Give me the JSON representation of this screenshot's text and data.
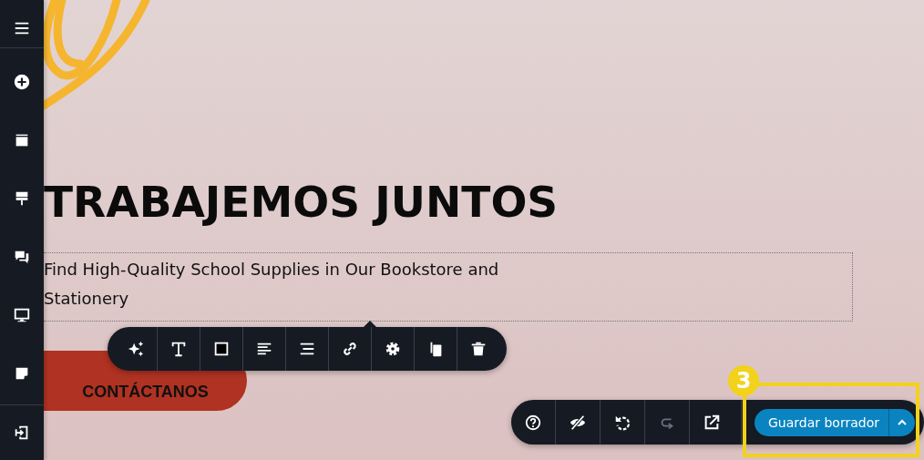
{
  "sidebar": {
    "items": [
      {
        "kind": "menu"
      },
      {
        "kind": "add"
      },
      {
        "kind": "pages"
      },
      {
        "kind": "brush"
      },
      {
        "kind": "chat"
      },
      {
        "kind": "monitor"
      },
      {
        "kind": "note"
      },
      {
        "kind": "exit"
      }
    ]
  },
  "hero": {
    "heading": "TRABAJEMOS JUNTOS",
    "text": "Find High-Quality School Supplies in Our Bookstore and Stationery",
    "button": "CONTÁCTANOS"
  },
  "element_toolbar": {
    "tools": [
      {
        "kind": "sparkle"
      },
      {
        "kind": "text"
      },
      {
        "kind": "square"
      },
      {
        "kind": "align"
      },
      {
        "kind": "center"
      },
      {
        "kind": "link"
      },
      {
        "kind": "gear"
      },
      {
        "kind": "copy"
      },
      {
        "kind": "trash"
      }
    ]
  },
  "bottom_bar": {
    "tools": [
      {
        "kind": "help",
        "disabled": false
      },
      {
        "kind": "hide",
        "disabled": false
      },
      {
        "kind": "undo",
        "disabled": false
      },
      {
        "kind": "redo",
        "disabled": true
      },
      {
        "kind": "open",
        "disabled": false
      }
    ],
    "save_button": "Guardar borrador"
  },
  "annotation": {
    "number": "3"
  }
}
